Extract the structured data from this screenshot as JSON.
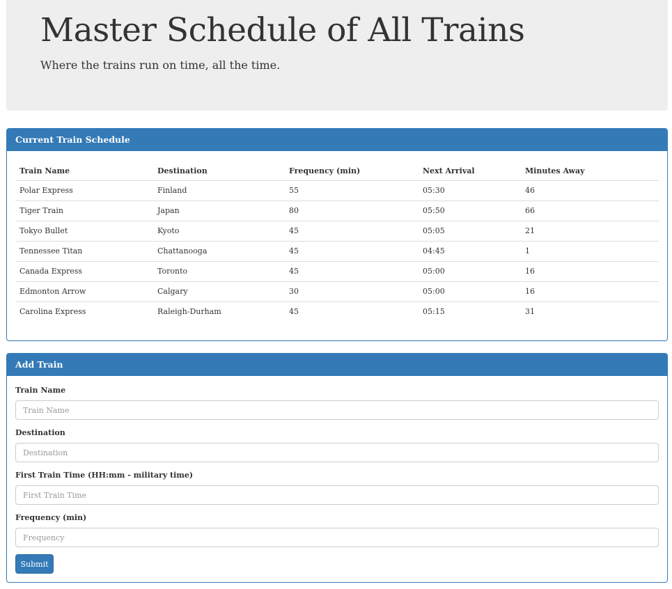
{
  "header": {
    "title": "Master Schedule of All Trains",
    "tagline": "Where the trains run on time, all the time."
  },
  "schedule": {
    "heading": "Current Train Schedule",
    "columns": [
      "Train Name",
      "Destination",
      "Frequency (min)",
      "Next Arrival",
      "Minutes Away"
    ],
    "rows": [
      [
        "Polar Express",
        "Finland",
        "55",
        "05:30",
        "46"
      ],
      [
        "Tiger Train",
        "Japan",
        "80",
        "05:50",
        "66"
      ],
      [
        "Tokyo Bullet",
        "Kyoto",
        "45",
        "05:05",
        "21"
      ],
      [
        "Tennessee Titan",
        "Chattanooga",
        "45",
        "04:45",
        "1"
      ],
      [
        "Canada Express",
        "Toronto",
        "45",
        "05:00",
        "16"
      ],
      [
        "Edmonton Arrow",
        "Calgary",
        "30",
        "05:00",
        "16"
      ],
      [
        "Carolina Express",
        "Raleigh-Durham",
        "45",
        "05:15",
        "31"
      ]
    ]
  },
  "add_train": {
    "heading": "Add Train",
    "fields": [
      {
        "label": "Train Name",
        "placeholder": "Train Name",
        "value": ""
      },
      {
        "label": "Destination",
        "placeholder": "Destination",
        "value": ""
      },
      {
        "label": "First Train Time (HH:mm - military time)",
        "placeholder": "First Train Time",
        "value": ""
      },
      {
        "label": "Frequency (min)",
        "placeholder": "Frequency",
        "value": ""
      }
    ],
    "submit_label": "Submit"
  },
  "colors": {
    "primary": "#337ab7",
    "jumbotron_bg": "#eeeeee",
    "text": "#333333",
    "border": "#dddddd"
  }
}
